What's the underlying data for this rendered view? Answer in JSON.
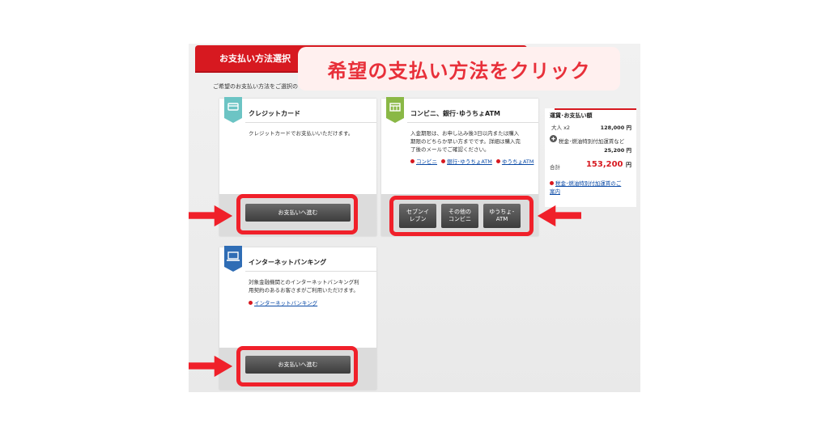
{
  "header": {
    "title": "お支払い方法選択"
  },
  "intro": "ご希望のお支払い方法をご選択の",
  "callout": "希望の支払い方法をクリック",
  "cards": {
    "credit": {
      "title": "クレジットカード",
      "desc": "クレジットカードでお支払いいただけます。",
      "button": "お支払いへ進む"
    },
    "conbini": {
      "title": "コンビニ、銀行･ゆうちょATM",
      "desc1": "入金期限は、お申し込み後3日以内または購入",
      "desc2": "期限のどちらか早い方までです。詳細は購入完",
      "desc3": "了後のメールでご確認ください。",
      "links": [
        "コンビニ",
        "銀行･ゆうちょATM",
        "ゆうちょATM"
      ],
      "buttons": [
        {
          "l1": "セブンイ",
          "l2": "レブン"
        },
        {
          "l1": "その他の",
          "l2": "コンビニ"
        },
        {
          "l1": "ゆうちょ･",
          "l2": "ATM"
        }
      ]
    },
    "netbank": {
      "title": "インターネットバンキング",
      "desc1": "対象金融機関とのインターネットバンキング利",
      "desc2": "用契約のあるお客さまがご利用いただけます。",
      "link": "インターネットバンキング",
      "button": "お支払いへ進む"
    }
  },
  "summary": {
    "title": "運賃･お支払い額",
    "adult_label": "大人 x2",
    "adult_value": "128,000 円",
    "tax_label1": "税金･燃油特別付加運賃など",
    "tax_value": "25,200 円",
    "total_label": "合計",
    "total_value": "153,200",
    "total_unit": "円",
    "link1": "税金･燃油特別付加運賃のご",
    "link2": "案内"
  },
  "colors": {
    "accent": "#d71920",
    "highlight": "#f0202a",
    "callout_text": "#e8303a"
  }
}
